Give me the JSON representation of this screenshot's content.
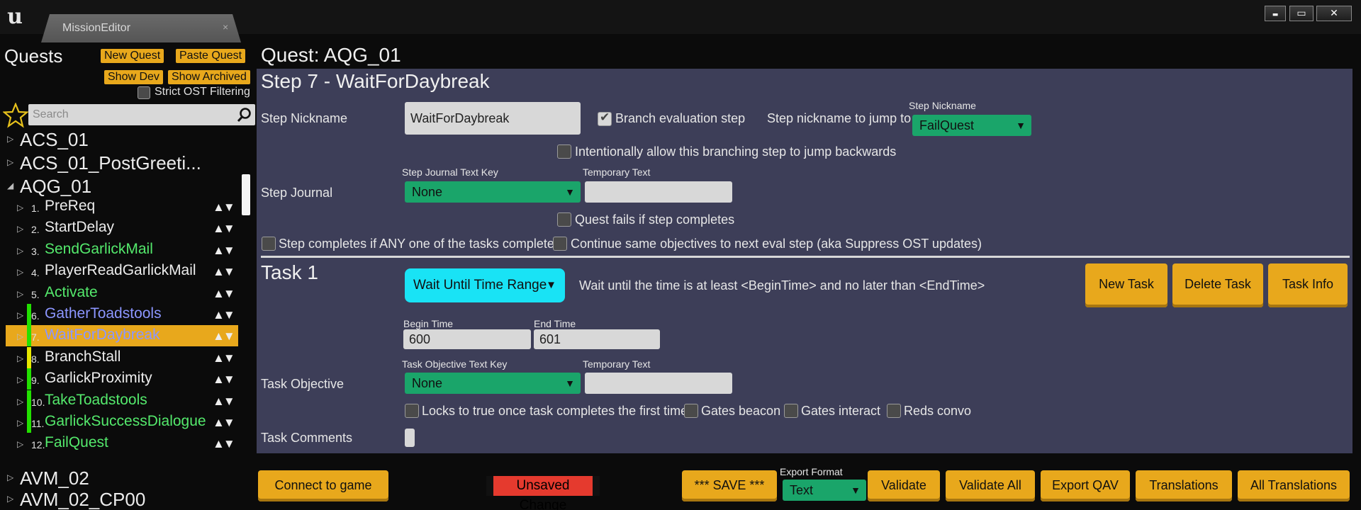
{
  "window": {
    "tab_title": "MissionEditor",
    "tab_close": "×",
    "controls": {
      "minimize": "▬",
      "maximize": "▭",
      "close": "✕"
    }
  },
  "left": {
    "title": "Quests",
    "buttons": {
      "new_quest": "New Quest",
      "paste_quest": "Paste Quest",
      "show_dev": "Show Dev",
      "show_archived": "Show Archived"
    },
    "strict_filter_label": "Strict OST Filtering",
    "search_placeholder": "Search",
    "top_items": [
      {
        "label": "ACS_01",
        "expanded": false
      },
      {
        "label": "ACS_01_PostGreeti...",
        "expanded": false
      },
      {
        "label": "AQG_01",
        "expanded": true
      }
    ],
    "steps": [
      {
        "num": "1.",
        "name": "PreReq",
        "color": "#ececec",
        "bar": ""
      },
      {
        "num": "2.",
        "name": "StartDelay",
        "color": "#ececec",
        "bar": ""
      },
      {
        "num": "3.",
        "name": "SendGarlickMail",
        "color": "#54e96c",
        "bar": ""
      },
      {
        "num": "4.",
        "name": "PlayerReadGarlickMail",
        "color": "#ececec",
        "bar": ""
      },
      {
        "num": "5.",
        "name": "Activate",
        "color": "#54e96c",
        "bar": ""
      },
      {
        "num": "6.",
        "name": "GatherToadstools",
        "color": "#8c96ff",
        "bar": "#22e000"
      },
      {
        "num": "7.",
        "name": "WaitForDaybreak",
        "color": "#8c96ff",
        "bar": "#22e000",
        "selected": true
      },
      {
        "num": "8.",
        "name": "BranchStall",
        "color": "#ececec",
        "bar": "#e8e800"
      },
      {
        "num": "9.",
        "name": "GarlickProximity",
        "color": "#ececec",
        "bar": "#22e000"
      },
      {
        "num": "10.",
        "name": "TakeToadstools",
        "color": "#54e96c",
        "bar": "#22e000"
      },
      {
        "num": "11.",
        "name": "GarlickSuccessDialogue",
        "color": "#54e96c",
        "bar": "#22e000"
      },
      {
        "num": "12.",
        "name": "FailQuest",
        "color": "#54e96c",
        "bar": ""
      }
    ],
    "bottom_items": [
      {
        "label": "AVM_02"
      },
      {
        "label": "AVM_02_CP00"
      }
    ],
    "move_glyph": "▲▼",
    "expand_glyph": "▷",
    "expanded_glyph": "◢"
  },
  "quest": {
    "title": "Quest: AQG_01"
  },
  "step": {
    "title": "Step 7 - WaitForDaybreak",
    "nickname_label": "Step Nickname",
    "nickname_value": "WaitForDaybreak",
    "branch_eval_label": "Branch evaluation step",
    "jump_label": "Step nickname to jump to",
    "jump_dropdown_caption": "Step Nickname",
    "jump_value": "FailQuest",
    "allow_backwards_label": "Intentionally allow this branching step to jump backwards",
    "journal_label": "Step Journal",
    "journal_key_caption": "Step Journal Text Key",
    "journal_key_value": "None",
    "temp_text_caption": "Temporary Text",
    "temp_text_value": "",
    "quest_fails_label": "Quest fails if step completes",
    "any_task_label": "Step completes if ANY one of the tasks completes",
    "continue_label": "Continue same objectives to next eval step (aka Suppress OST updates)"
  },
  "task": {
    "title": "Task 1",
    "type_value": "Wait Until Time Range",
    "type_desc": "Wait until the time is at least <BeginTime> and no later than <EndTime>",
    "buttons": {
      "new": "New Task",
      "delete": "Delete Task",
      "info": "Task Info"
    },
    "begin_caption": "Begin Time",
    "begin_value": "600",
    "end_caption": "End Time",
    "end_value": "601",
    "objective_label": "Task Objective",
    "objective_key_caption": "Task Objective Text Key",
    "objective_key_value": "None",
    "temp_text_caption": "Temporary Text",
    "temp_text_value": "",
    "locks_label": "Locks to true once task completes the first time",
    "gates_beacon_label": "Gates beacon",
    "gates_interact_label": "Gates interact",
    "reds_convo_label": "Reds convo",
    "comments_label": "Task Comments",
    "comments_value": ""
  },
  "bottom": {
    "connect": "Connect to game",
    "unsaved": "Unsaved Change",
    "save": "*** SAVE ***",
    "export_caption": "Export Format",
    "export_value": "Text",
    "validate": "Validate",
    "validate_all": "Validate All",
    "export_qav": "Export QAV",
    "translations": "Translations",
    "all_translations": "All Translations"
  },
  "colors": {
    "accent_yellow": "#e8a81c",
    "dropdown_green": "#1aa56a",
    "cyan_button": "#19e3f5",
    "panel": "#3d3e58",
    "unsaved_red": "#e53a2e"
  }
}
